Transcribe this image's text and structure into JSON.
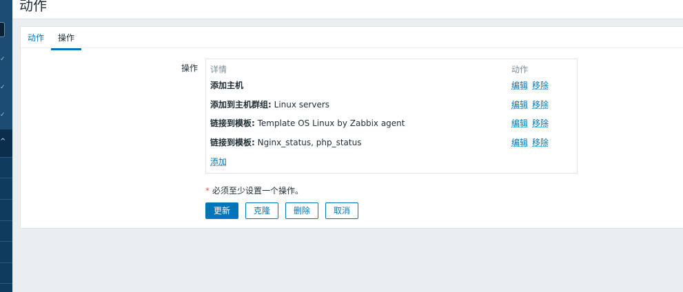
{
  "page": {
    "title": "动作"
  },
  "tabs": [
    {
      "label": "动作"
    },
    {
      "label": "操作"
    }
  ],
  "form": {
    "field_label": "操作",
    "table": {
      "col_detail": "详情",
      "col_action": "动作",
      "rows": [
        {
          "bold": "添加主机",
          "rest": "",
          "edit": "编辑",
          "remove": "移除"
        },
        {
          "bold": "添加到主机群组:",
          "rest": " Linux servers",
          "edit": "编辑",
          "remove": "移除"
        },
        {
          "bold": "链接到模板:",
          "rest": " Template OS Linux by Zabbix agent",
          "edit": "编辑",
          "remove": "移除"
        },
        {
          "bold": "链接到模板:",
          "rest": " Nginx_status, php_status",
          "edit": "编辑",
          "remove": "移除"
        }
      ],
      "add_link": "添加"
    },
    "required_star": "*",
    "required_note": "必须至少设置一个操作。"
  },
  "buttons": {
    "update": "更新",
    "clone": "克隆",
    "delete": "删除",
    "cancel": "取消"
  },
  "colors": {
    "accent": "#0275b8",
    "sidebar": "#0f3b5f",
    "required": "#e45959"
  }
}
